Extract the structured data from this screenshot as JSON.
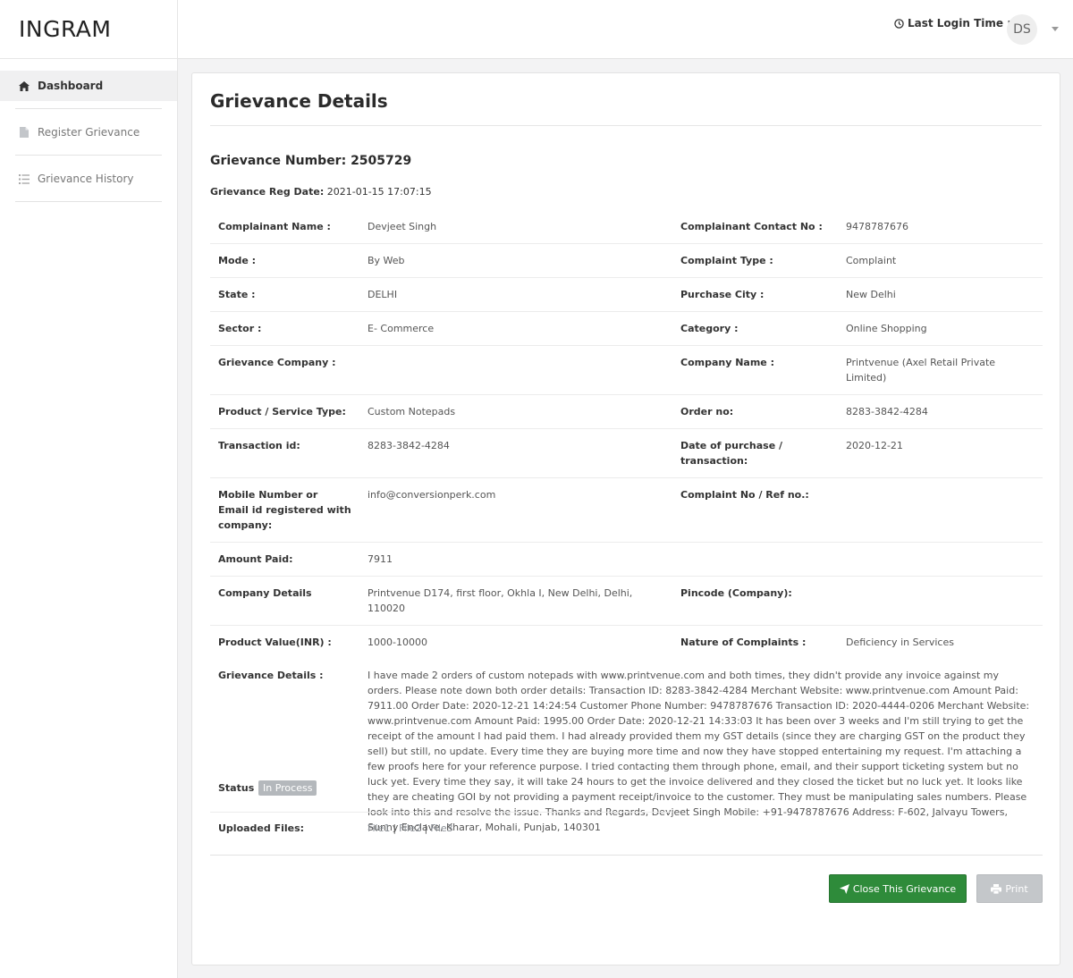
{
  "brand": "INGRAM",
  "sidebar": {
    "items": [
      {
        "label": "Dashboard",
        "icon": "home-icon",
        "active": true
      },
      {
        "label": "Register Grievance",
        "icon": "document-icon",
        "active": false
      },
      {
        "label": "Grievance History",
        "icon": "list-icon",
        "active": false
      }
    ]
  },
  "topbar": {
    "last_login_label": "Last Login Time :",
    "avatar_initials": "DS"
  },
  "page": {
    "title": "Grievance Details",
    "grievance_number": "Grievance Number: 2505729",
    "reg_date_label": "Grievance Reg Date:",
    "reg_date_value": "2021-01-15 17:07:15"
  },
  "details": [
    {
      "l1": "Complainant Name :",
      "v1": "Devjeet Singh",
      "l2": "Complainant Contact No :",
      "v2": "9478787676"
    },
    {
      "l1": "Mode :",
      "v1": "By Web",
      "l2": "Complaint Type :",
      "v2": "Complaint"
    },
    {
      "l1": "State :",
      "v1": "DELHI",
      "l2": "Purchase City :",
      "v2": "New Delhi"
    },
    {
      "l1": "Sector :",
      "v1": "E- Commerce",
      "l2": "Category :",
      "v2": "Online Shopping"
    },
    {
      "l1": "Grievance Company :",
      "v1": "",
      "l2": "Company Name :",
      "v2": "Printvenue (Axel Retail Private Limited)"
    },
    {
      "l1": "Product / Service Type:",
      "v1": "Custom Notepads",
      "l2": "Order no:",
      "v2": "8283-3842-4284"
    },
    {
      "l1": "Transaction id:",
      "v1": "8283-3842-4284",
      "l2": "Date of purchase / transaction:",
      "v2": "2020-12-21"
    },
    {
      "l1": "Mobile Number or Email id registered with company:",
      "v1": "info@conversionperk.com",
      "l2": "Complaint No / Ref no.:",
      "v2": ""
    },
    {
      "l1": "Amount Paid:",
      "v1": "7911",
      "l2": "",
      "v2": ""
    },
    {
      "l1": "Company Details",
      "v1": "Printvenue D174, first floor, Okhla I, New Delhi, Delhi, 110020",
      "l2": "Pincode (Company):",
      "v2": ""
    },
    {
      "l1": "Product Value(INR) :",
      "v1": "1000-10000",
      "l2": "Nature of Complaints :",
      "v2": "Deficiency in Services"
    }
  ],
  "grievance_details": {
    "label": "Grievance Details :",
    "text": "I have made 2 orders of custom notepads with www.printvenue.com and both times, they didn't provide any invoice against my orders. Please note down both order details: Transaction ID: 8283-3842-4284 Merchant Website: www.printvenue.com Amount Paid: 7911.00 Order Date: 2020-12-21 14:24:54 Customer Phone Number: 9478787676 Transaction ID: 2020-4444-0206 Merchant Website: www.printvenue.com Amount Paid: 1995.00 Order Date: 2020-12-21 14:33:03 It has been over 3 weeks and I'm still trying to get the receipt of the amount I had paid them. I had already provided them my GST details (since they are charging GST on the product they sell) but still, no update. Every time they are buying more time and now they have stopped entertaining my request. I'm attaching a few proofs here for your reference purpose. I tried contacting them through phone, email, and their support ticketing system but no luck yet. Every time they say, it will take 24 hours to get the invoice delivered and they closed the ticket but no luck yet. It looks like they are cheating GOI by not providing a payment receipt/invoice to the customer. They must be manipulating sales numbers. Please look into this and resolve the issue. Thanks and Regards, Devjeet Singh Mobile: +91-9478787676 Address: F-602, Jalvayu Towers, Sunny Enclave, Kharar, Mohali, Punjab, 140301"
  },
  "status": {
    "label": "Status :",
    "value": "In Process",
    "color": "#b4b8bc"
  },
  "uploaded": {
    "label": "Uploaded Files:",
    "files": [
      "File1",
      "File2",
      "File3"
    ],
    "separator": "|"
  },
  "actions": {
    "close_label": "Close This Grievance",
    "print_label": "Print",
    "close_color": "#2e8b3a",
    "print_color": "#c4c7ca"
  }
}
